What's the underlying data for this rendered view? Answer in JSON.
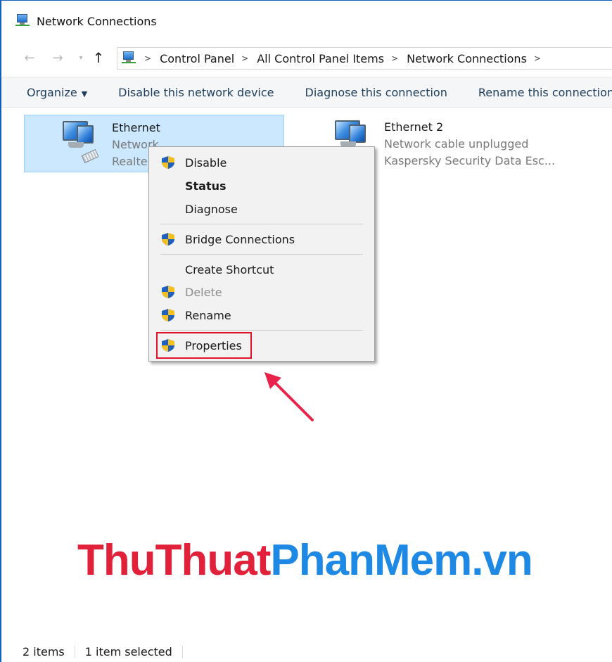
{
  "window": {
    "title": "Network Connections"
  },
  "address": {
    "crumbs": [
      "Control Panel",
      "All Control Panel Items",
      "Network Connections"
    ],
    "separator": ">"
  },
  "toolbar": {
    "organize": "Organize",
    "disable": "Disable this network device",
    "diagnose": "Diagnose this connection",
    "rename": "Rename this connection"
  },
  "items": [
    {
      "name": "Ethernet",
      "status": "Network",
      "device": "Realte",
      "selected": true
    },
    {
      "name": "Ethernet 2",
      "status": "Network cable unplugged",
      "device": "Kaspersky Security Data Esc...",
      "selected": false
    }
  ],
  "context_menu": {
    "disable": "Disable",
    "status": "Status",
    "diagnose": "Diagnose",
    "bridge": "Bridge Connections",
    "shortcut": "Create Shortcut",
    "delete": "Delete",
    "rename": "Rename",
    "properties": "Properties"
  },
  "watermark": {
    "part1": "ThuThuat",
    "part2": "PhanMem.vn"
  },
  "status_bar": {
    "count": "2 items",
    "selected": "1 item selected"
  },
  "colors": {
    "accent": "#0f60b6",
    "selection": "#cce8ff",
    "highlight": "#e0152b",
    "watermark_red": "#e1203a",
    "watermark_blue": "#1e88e5"
  }
}
